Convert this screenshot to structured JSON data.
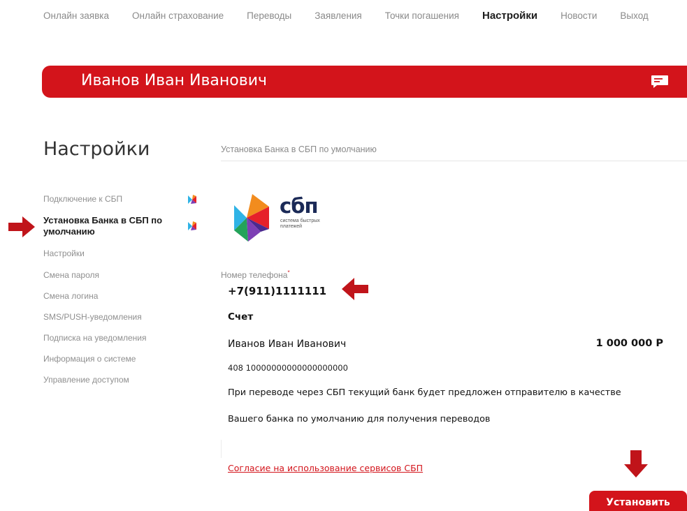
{
  "topnav": {
    "items": [
      "Онлайн заявка",
      "Онлайн страхование",
      "Переводы",
      "Заявления",
      "Точки погашения",
      "Настройки",
      "Новости",
      "Выход"
    ],
    "active_index": 5
  },
  "banner": {
    "user_name": "Иванов Иван Иванович",
    "icon": "message-icon"
  },
  "sidebar": {
    "title": "Настройки",
    "items": [
      {
        "label": "Подключение к СБП",
        "icon": "sbp-icon"
      },
      {
        "label": "Установка Банка в СБП по умолчанию",
        "icon": "sbp-icon",
        "active": true
      },
      {
        "label": "Настройки"
      },
      {
        "label": "Смена пароля"
      },
      {
        "label": "Смена логина"
      },
      {
        "label": "SMS/PUSH-уведомления"
      },
      {
        "label": "Подписка на уведомления"
      },
      {
        "label": "Информация о системе"
      },
      {
        "label": "Управление доступом"
      }
    ]
  },
  "content": {
    "header": "Установка Банка в СБП по умолчанию",
    "logo": {
      "word": "сбп",
      "subtitle": "система быстрых платежей"
    },
    "phone_label": "Номер телефона",
    "phone_required_mark": "*",
    "phone_value": "+7(911)1111111",
    "account_label": "Счет",
    "account_holder": "Иванов Иван Иванович",
    "account_amount": "1 000 000 Р",
    "account_number": "408 10000000000000000000",
    "info_line_1": "При переводе через СБП текущий банк будет предложен отправителю в качестве",
    "info_line_2": "Вашего банка по умолчанию для получения переводов",
    "consent_link": "Согласие на использование сервисов СБП",
    "install_button": "Установить"
  },
  "colors": {
    "accent": "#d3141b",
    "muted": "#8a8a8a",
    "text": "#111111"
  }
}
